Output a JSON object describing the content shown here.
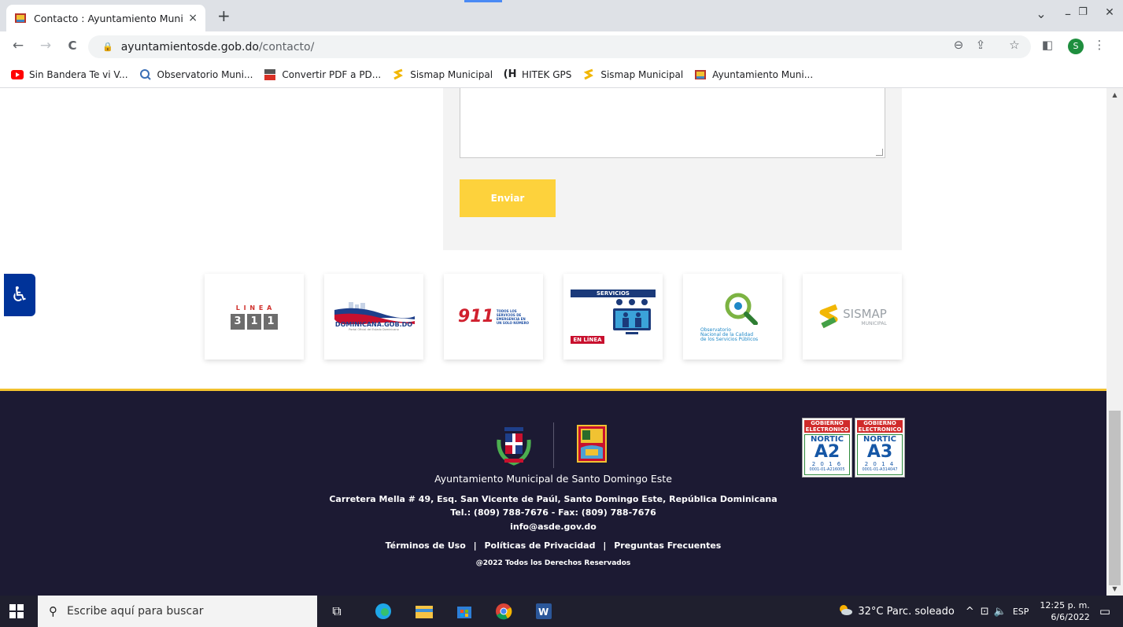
{
  "browser": {
    "tab_title": "Contacto : Ayuntamiento Municip",
    "tab_close": "×",
    "new_tab": "+",
    "url_host": "ayuntamientosde.gob.do",
    "url_path": "/contacto/",
    "window_controls": {
      "dropdown": "⌄",
      "minimize": "–",
      "restore": "❐",
      "close": "✕"
    },
    "nav": {
      "back": "←",
      "forward": "→",
      "reload": "C"
    },
    "profile_initial": "S",
    "bookmarks": [
      {
        "label": "Sin Bandera Te vi V...",
        "icon": "youtube-icon"
      },
      {
        "label": "Observatorio Muni...",
        "icon": "observatorio-icon"
      },
      {
        "label": "Convertir PDF a PD...",
        "icon": "pdf24-icon"
      },
      {
        "label": "Sismap Municipal",
        "icon": "sismap-icon"
      },
      {
        "label": "HITEK GPS",
        "icon": "hitek-icon"
      },
      {
        "label": "Sismap Municipal",
        "icon": "sismap-icon"
      },
      {
        "label": "Ayuntamiento Muni...",
        "icon": "ayuntamiento-icon"
      }
    ]
  },
  "form": {
    "send_label": "Enviar"
  },
  "logos": [
    {
      "name": "linea-311-logo",
      "top": "L I N E A",
      "digits": [
        "3",
        "1",
        "1"
      ]
    },
    {
      "name": "dominicana-gob-logo",
      "text": "DOMINICANA.GOB.DO",
      "sub": "Portal Oficial del Estado Dominicano"
    },
    {
      "name": "911-logo",
      "text": "911",
      "sub1": "TODOS LOS",
      "sub2": "SERVICIOS DE",
      "sub3": "EMERGENCIA EN",
      "sub4": "UN SOLO NÚMERO"
    },
    {
      "name": "servicios-en-linea-logo",
      "top": "SERVICIOS",
      "mid": "EN LÍNEA"
    },
    {
      "name": "observatorio-logo",
      "line1": "Observatorio",
      "line2": "Nacional de la Calidad",
      "line3": "de los Servicios Públicos"
    },
    {
      "name": "sismap-logo",
      "text": "SISMAP",
      "sub": "MUNICIPAL"
    }
  ],
  "footer": {
    "org_name": "Ayuntamiento Municipal de Santo Domingo Este",
    "address": "Carretera Mella # 49, Esq. San Vicente de Paúl, Santo Domingo Este, República Dominicana",
    "phone": "Tel.: (809) 788-7676 - Fax: (809) 788-7676",
    "email": "info@asde.gov.do",
    "links": [
      "Términos de Uso",
      "Políticas de Privacidad",
      "Preguntas Frecuentes"
    ],
    "link_sep": "|",
    "copyright": "@2022 Todos los Derechos Reservados",
    "nortic": [
      {
        "gob": "GOBIERNO",
        "elec": "ELECTRONICO",
        "label": "NORTIC",
        "code": "A2",
        "year": "2 0 1 6",
        "cert": "0001-01-A216005"
      },
      {
        "gob": "GOBIERNO",
        "elec": "ELECTRONICO",
        "label": "NORTIC",
        "code": "A3",
        "year": "2 0 1 4",
        "cert": "0001-01-A314047"
      }
    ]
  },
  "taskbar": {
    "search_placeholder": "Escribe aquí para buscar",
    "weather": "32°C  Parc. soleado",
    "language": "ESP",
    "time": "12:25 p. m.",
    "date": "6/6/2022"
  }
}
